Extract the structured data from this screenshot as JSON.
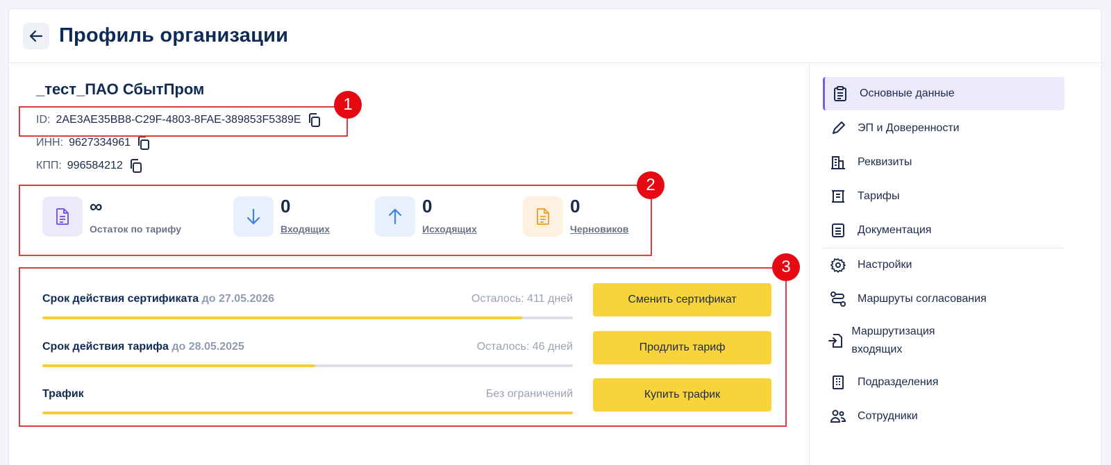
{
  "header": {
    "title": "Профиль организации",
    "back_icon": "arrow-left-icon"
  },
  "org": {
    "name": "_тест_ПАО СбытПром",
    "id_label": "ID:",
    "id_value": "2AE3AE35BB8-C29F-4803-8FAE-389853F5389E",
    "inn_label": "ИНН:",
    "inn_value": "9627334961",
    "kpp_label": "КПП:",
    "kpp_value": "996584212"
  },
  "stats": [
    {
      "value": "∞",
      "label": "Остаток по тарифу",
      "icon": "document-icon",
      "color": "#7a5ce0",
      "bg": "#ece9fb"
    },
    {
      "value": "0",
      "label": "Входящих",
      "icon": "arrow-down-icon",
      "color": "#3f7fe6",
      "bg": "#e8f0fd"
    },
    {
      "value": "0",
      "label": "Исходящих",
      "icon": "arrow-up-icon",
      "color": "#3f7fe6",
      "bg": "#e8f0fd"
    },
    {
      "value": "0",
      "label": "Черновиков",
      "icon": "draft-document-icon",
      "color": "#f2a33a",
      "bg": "#fdf2e2"
    }
  ],
  "limits": [
    {
      "title": "Срок действия сертификата",
      "date": "до 27.05.2026",
      "remain": "Осталось: 411 дней",
      "progress": 0.905,
      "button": "Сменить сертификат"
    },
    {
      "title": "Срок действия тарифа",
      "date": "до 28.05.2025",
      "remain": "Осталось: 46 дней",
      "progress": 0.515,
      "button": "Продлить тариф"
    },
    {
      "title": "Трафик",
      "date": "",
      "remain": "Без ограничений",
      "progress": 1.0,
      "button": "Купить трафик"
    }
  ],
  "sidebar": {
    "items": [
      {
        "label": "Основные данные",
        "icon": "clipboard-icon",
        "active": true
      },
      {
        "label": "ЭП и Доверенности",
        "icon": "pen-icon"
      },
      {
        "label": "Реквизиты",
        "icon": "building-icon"
      },
      {
        "label": "Тарифы",
        "icon": "tariff-icon"
      },
      {
        "label": "Документация",
        "icon": "doc-list-icon"
      },
      {
        "label": "Настройки",
        "icon": "gear-icon"
      },
      {
        "label": "Маршруты согласования",
        "icon": "route-icon"
      },
      {
        "label": "Маршрутизация входящих",
        "icon": "inbox-route-icon"
      },
      {
        "label": "Подразделения",
        "icon": "office-icon"
      },
      {
        "label": "Сотрудники",
        "icon": "users-icon"
      }
    ]
  },
  "annotations": [
    "1",
    "2",
    "3"
  ],
  "colors": {
    "accent": "#7a5ce0",
    "button": "#f8d33a",
    "progress": "#f7ce3a",
    "annotation": "#e50914"
  }
}
